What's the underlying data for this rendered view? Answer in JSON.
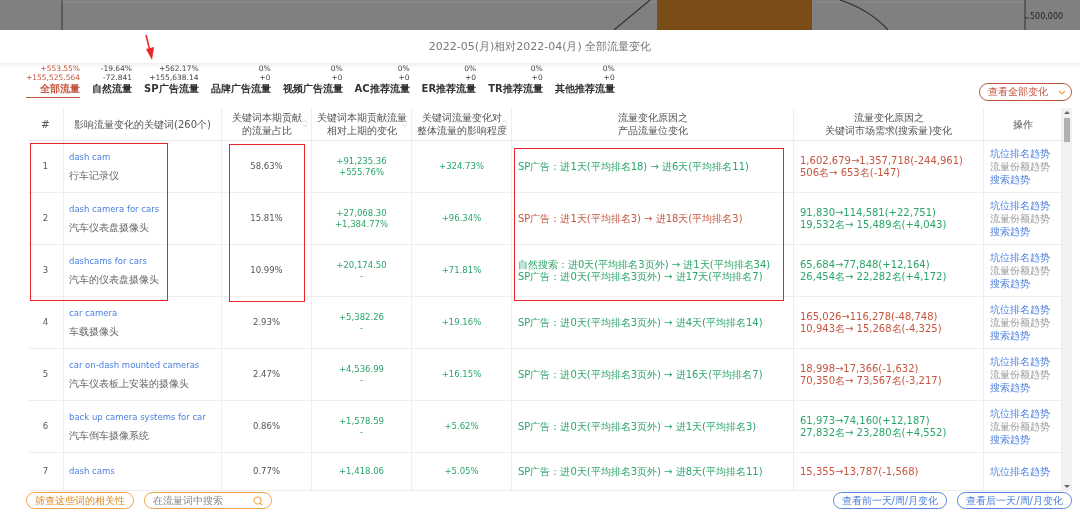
{
  "backdrop": {
    "axis_label": "500,000"
  },
  "title": "2022-05(月)相对2022-04(月) 全部流量变化",
  "tabs": [
    {
      "change_pct": "+553.55%",
      "change_value": "+155,525.564",
      "label": "全部流量",
      "selected": true
    },
    {
      "change_pct": "-19.64%",
      "change_value": "-72.841",
      "label": "自然流量",
      "selected": false
    },
    {
      "change_pct": "+562.17%",
      "change_value": "+155,638.14",
      "label": "SP广告流量",
      "selected": false
    },
    {
      "change_pct": "0%",
      "change_value": "+0",
      "label": "品牌广告流量",
      "selected": false
    },
    {
      "change_pct": "0%",
      "change_value": "+0",
      "label": "视频广告流量",
      "selected": false
    },
    {
      "change_pct": "0%",
      "change_value": "+0",
      "label": "AC推荐流量",
      "selected": false
    },
    {
      "change_pct": "0%",
      "change_value": "+0",
      "label": "ER推荐流量",
      "selected": false
    },
    {
      "change_pct": "0%",
      "change_value": "+0",
      "label": "TR推荐流量",
      "selected": false
    },
    {
      "change_pct": "0%",
      "change_value": "+0",
      "label": "其他推荐流量",
      "selected": false
    }
  ],
  "view_select": {
    "value": "查看全部变化"
  },
  "table": {
    "columns": [
      {
        "label_lines": [
          "#"
        ],
        "sortable": false
      },
      {
        "label_lines": [
          "影响流量变化的关键词(260个)"
        ],
        "sortable": false
      },
      {
        "label_lines": [
          "关键词本期贡献",
          "的流量占比"
        ],
        "sortable": true
      },
      {
        "label_lines": [
          "关键词本期贡献流量",
          "相对上期的变化"
        ],
        "sortable": true
      },
      {
        "label_lines": [
          "关键词流量变化对",
          "整体流量的影响程度"
        ],
        "sortable": true
      },
      {
        "label_lines": [
          "流量变化原因之",
          "产品流量位变化"
        ],
        "sortable": false
      },
      {
        "label_lines": [
          "流量变化原因之",
          "关键词市场需求(搜索量)变化"
        ],
        "sortable": false
      },
      {
        "label_lines": [
          "操作"
        ],
        "sortable": false
      }
    ],
    "rows": [
      {
        "rank": "1",
        "keyword": "dash cam",
        "keyword_cn": "行车记录仪",
        "share": "58.63%",
        "change": [
          "+91,235.36",
          "+555.76%"
        ],
        "impact": "+324.73%",
        "reason": {
          "decrease": false,
          "lines": [
            "SP广告：进1天(平均排名18) → 进6天(平均排名11)"
          ]
        },
        "market": {
          "decrease": true,
          "lines": [
            "1,602,679→1,357,718(-244,961)",
            "506名→ 653名(-147)"
          ]
        },
        "actions": [
          {
            "label": "坑位排名趋势",
            "disabled": false
          },
          {
            "label": "流量份额趋势",
            "disabled": true
          },
          {
            "label": "搜索趋势",
            "disabled": false
          }
        ]
      },
      {
        "rank": "2",
        "keyword": "dash camera for cars",
        "keyword_cn": "汽车仪表盘摄像头",
        "share": "15.81%",
        "change": [
          "+27,068.30",
          "+1,384.77%"
        ],
        "impact": "+96.34%",
        "reason": {
          "decrease": true,
          "lines": [
            "SP广告：进1天(平均排名3) → 进18天(平均排名3)"
          ]
        },
        "market": {
          "decrease": false,
          "lines": [
            "91,830→114,581(+22,751)",
            "19,532名→ 15,489名(+4,043)"
          ]
        },
        "actions": [
          {
            "label": "坑位排名趋势",
            "disabled": false
          },
          {
            "label": "流量份额趋势",
            "disabled": true
          },
          {
            "label": "搜索趋势",
            "disabled": false
          }
        ]
      },
      {
        "rank": "3",
        "keyword": "dashcams for cars",
        "keyword_cn": "汽车的仪表盘摄像头",
        "share": "10.99%",
        "change": [
          "+20,174.50",
          "-"
        ],
        "impact": "+71.81%",
        "reason": {
          "decrease": false,
          "lines": [
            "自然搜索：进0天(平均排名3页外) → 进1天(平均排名34)",
            "SP广告：进0天(平均排名3页外) → 进17天(平均排名7)"
          ]
        },
        "market": {
          "decrease": false,
          "lines": [
            "65,684→77,848(+12,164)",
            "26,454名→ 22,282名(+4,172)"
          ]
        },
        "actions": [
          {
            "label": "坑位排名趋势",
            "disabled": false
          },
          {
            "label": "流量份额趋势",
            "disabled": true
          },
          {
            "label": "搜索趋势",
            "disabled": false
          }
        ]
      },
      {
        "rank": "4",
        "keyword": "car camera",
        "keyword_cn": "车载摄像头",
        "share": "2.93%",
        "change": [
          "+5,382.26",
          "-"
        ],
        "impact": "+19.16%",
        "reason": {
          "decrease": false,
          "lines": [
            "SP广告：进0天(平均排名3页外) → 进4天(平均排名14)"
          ]
        },
        "market": {
          "decrease": true,
          "lines": [
            "165,026→116,278(-48,748)",
            "10,943名→ 15,268名(-4,325)"
          ]
        },
        "actions": [
          {
            "label": "坑位排名趋势",
            "disabled": false
          },
          {
            "label": "流量份额趋势",
            "disabled": true
          },
          {
            "label": "搜索趋势",
            "disabled": false
          }
        ]
      },
      {
        "rank": "5",
        "keyword": "car on-dash mounted cameras",
        "keyword_cn": "汽车仪表板上安装的摄像头",
        "share": "2.47%",
        "change": [
          "+4,536.99",
          "-"
        ],
        "impact": "+16.15%",
        "reason": {
          "decrease": false,
          "lines": [
            "SP广告：进0天(平均排名3页外) → 进16天(平均排名7)"
          ]
        },
        "market": {
          "decrease": true,
          "lines": [
            "18,998→17,366(-1,632)",
            "70,350名→ 73,567名(-3,217)"
          ]
        },
        "actions": [
          {
            "label": "坑位排名趋势",
            "disabled": false
          },
          {
            "label": "流量份额趋势",
            "disabled": true
          },
          {
            "label": "搜索趋势",
            "disabled": false
          }
        ]
      },
      {
        "rank": "6",
        "keyword": "back up camera systems for car",
        "keyword_cn": "汽车倒车摄像系统",
        "share": "0.86%",
        "change": [
          "+1,578.59",
          "-"
        ],
        "impact": "+5.62%",
        "reason": {
          "decrease": false,
          "lines": [
            "SP广告：进0天(平均排名3页外) → 进1天(平均排名3)"
          ]
        },
        "market": {
          "decrease": false,
          "lines": [
            "61,973→74,160(+12,187)",
            "27,832名→ 23,280名(+4,552)"
          ]
        },
        "actions": [
          {
            "label": "坑位排名趋势",
            "disabled": false
          },
          {
            "label": "流量份额趋势",
            "disabled": true
          },
          {
            "label": "搜索趋势",
            "disabled": false
          }
        ]
      },
      {
        "rank": "7",
        "keyword": "dash cams",
        "share": "0.77%",
        "change": [
          "+1,418.06"
        ],
        "impact": "+5.05%",
        "reason": {
          "decrease": false,
          "lines": [
            "SP广告：进0天(平均排名3页外) → 进8天(平均排名11)"
          ]
        },
        "market": {
          "decrease": true,
          "lines": [
            "15,355→13,787(-1,568)"
          ]
        },
        "actions": [
          {
            "label": "坑位排名趋势",
            "disabled": false
          }
        ]
      }
    ]
  },
  "footer": {
    "filter_button": "筛查这些词的相关性",
    "search": {
      "placeholder": "在流量词中搜索"
    },
    "prev_button": "查看前一天/周/月变化",
    "next_button": "查看后一天/周/月变化"
  }
}
